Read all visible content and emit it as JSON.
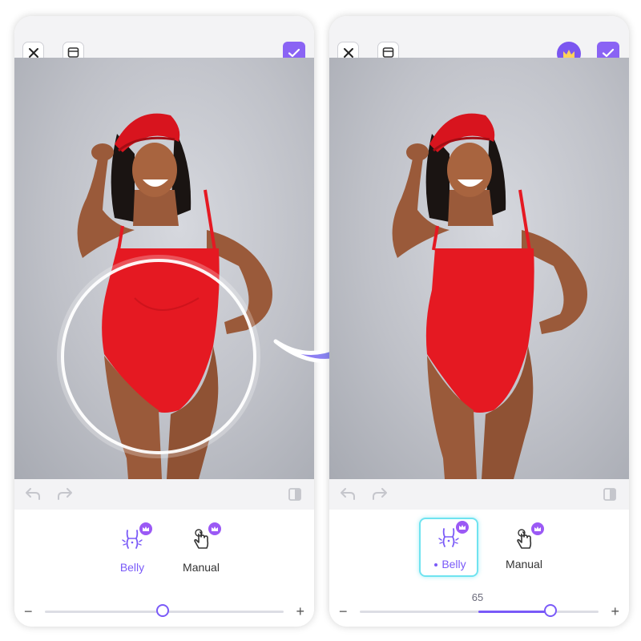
{
  "colors": {
    "accent": "#7a5af8",
    "confirm": "#8a63f4",
    "premium": "#9b59f5",
    "selected_outline": "#6fe3f0",
    "swimsuit": "#e51922",
    "skin": "#9a5a3a",
    "background_photo": "#c8cad0"
  },
  "left_screen": {
    "toolbar": {
      "close_icon": "close-icon",
      "compare_icon": "compare-icon",
      "confirm_icon": "checkmark-icon"
    },
    "tools": [
      {
        "label": "Belly",
        "icon": "belly-icon",
        "premium": true,
        "active": true
      },
      {
        "label": "Manual",
        "icon": "hand-touch-icon",
        "premium": true,
        "active": false
      }
    ],
    "slider": {
      "minus": "−",
      "plus": "+",
      "value": 0.5
    },
    "overlay": "glowing-circle-selection"
  },
  "right_screen": {
    "toolbar": {
      "close_icon": "close-icon",
      "compare_icon": "compare-icon",
      "premium_icon": "crown-icon",
      "confirm_icon": "checkmark-icon"
    },
    "tools": [
      {
        "label": "Belly",
        "icon": "belly-icon",
        "premium": true,
        "active": true,
        "selected": true
      },
      {
        "label": "Manual",
        "icon": "hand-touch-icon",
        "premium": true,
        "active": false
      }
    ],
    "slider": {
      "minus": "−",
      "plus": "+",
      "value_label": "65",
      "value": 0.65
    }
  },
  "transition_arrow": "before-after-arrow"
}
